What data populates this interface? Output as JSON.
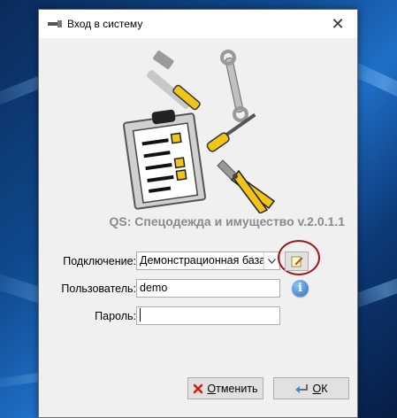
{
  "window": {
    "title": "Вход в систему",
    "app_title": "QS: Спецодежда и имущество v.2.0.1.1"
  },
  "form": {
    "connection_label": "Подключение:",
    "connection_value": "Демонстрационная база",
    "user_label": "Пользователь:",
    "user_value": "demo",
    "password_label": "Пароль:",
    "password_value": ""
  },
  "buttons": {
    "cancel_label": "Отменить",
    "cancel_accesskey": "О",
    "cancel_rest": "тменить",
    "ok_accesskey": "О",
    "ok_rest": "К"
  },
  "colors": {
    "title_gray": "#8a8a8a",
    "highlight_circle": "#a01818",
    "info_blue": "#2a6fc4"
  }
}
